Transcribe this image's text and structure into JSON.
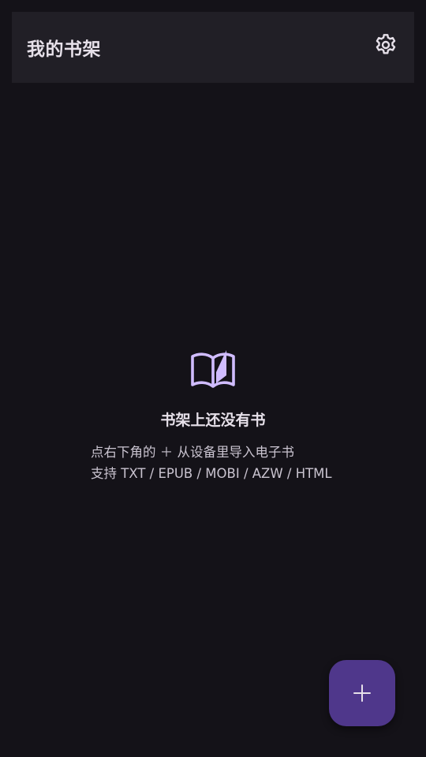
{
  "app_bar": {
    "title": "我的书架",
    "settings_icon": "gear-icon"
  },
  "empty_state": {
    "icon": "open-book-icon",
    "title": "书架上还没有书",
    "hint_line1": "点右下角的 ＋ 从设备里导入电子书",
    "hint_line2": "支持 TXT / EPUB / MOBI / AZW / HTML"
  },
  "fab": {
    "icon": "plus-icon"
  },
  "colors": {
    "background": "#141218",
    "app_bar": "#211f26",
    "accent": "#d0bcff",
    "fab": "#4f378b",
    "text_primary": "#e6e0e9",
    "text_secondary": "#cac4d0"
  }
}
